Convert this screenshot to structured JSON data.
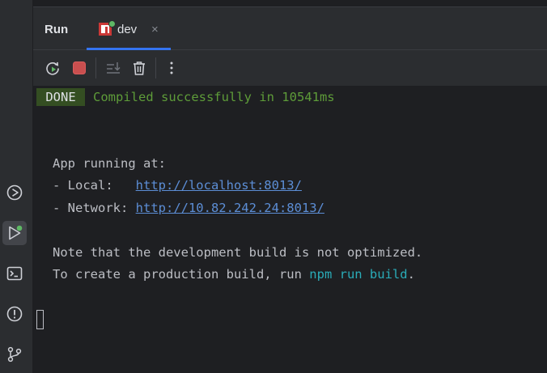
{
  "tool_window": {
    "title": "Run"
  },
  "tab": {
    "label": "dev",
    "close_glyph": "×"
  },
  "toolbar": {
    "icons": [
      "rerun-icon",
      "stop-icon",
      "scroll-to-end-icon",
      "clear-all-icon",
      "more-options-icon"
    ]
  },
  "left_bar": {
    "icons": [
      "services-icon",
      "run-icon",
      "terminal-icon",
      "problems-icon",
      "git-icon"
    ]
  },
  "console": {
    "badge": "DONE",
    "compiled": "Compiled successfully in 10541ms",
    "app_running": "App running at:",
    "local_label": "- Local:   ",
    "local_url": "http://localhost:8013/",
    "network_label": "- Network: ",
    "network_url": "http://10.82.242.24:8013/",
    "note": "Note that the development build is not optimized.",
    "prod_prefix": "To create a production build, run ",
    "prod_cmd": "npm run build",
    "prod_suffix": "."
  },
  "colors": {
    "accent": "#3574f0",
    "success_green": "#5e9c39",
    "badge_bg": "#344e22",
    "link": "#5c8ed6",
    "command": "#2aacb8",
    "stop_red": "#c94f4f"
  }
}
